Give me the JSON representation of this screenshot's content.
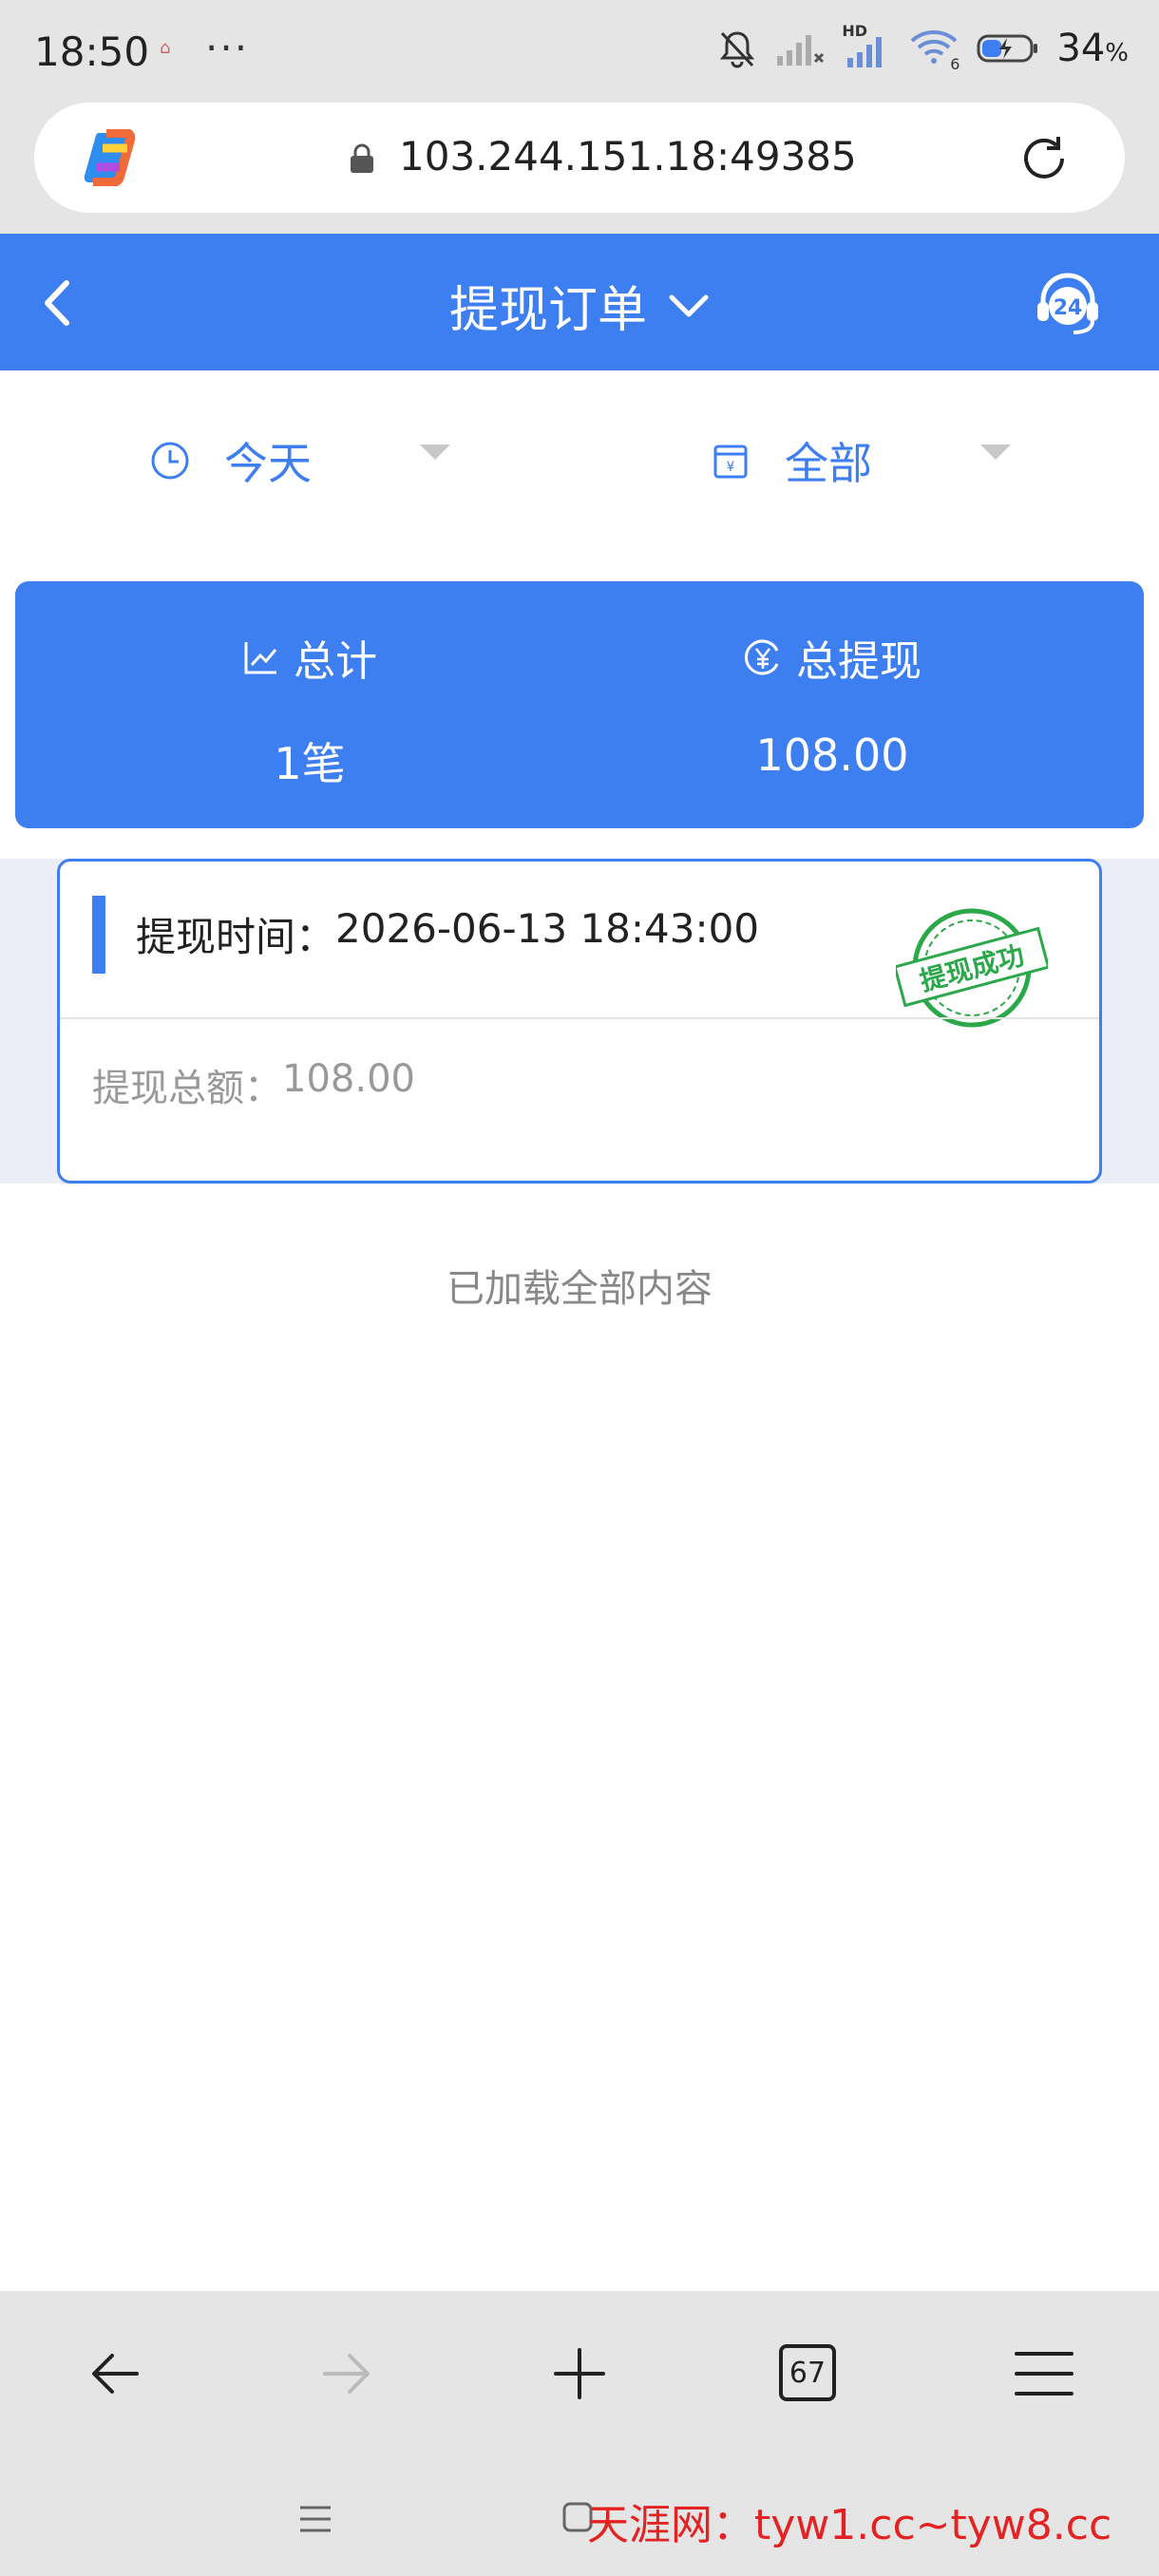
{
  "status_bar": {
    "time": "18:50",
    "tiny_label": "⌂",
    "more": "···",
    "network_label": "HD",
    "wifi_sub": "6",
    "battery_percent": "34",
    "battery_unit": "%"
  },
  "browser": {
    "url": "103.244.151.18:49385",
    "tab_count": "67"
  },
  "header": {
    "title": "提现订单"
  },
  "filters": {
    "date": "今天",
    "type": "全部"
  },
  "summary": {
    "count_label": "总计",
    "count_value": "1笔",
    "amount_label": "总提现",
    "amount_value": "108.00"
  },
  "orders": [
    {
      "time_label": "提现时间：",
      "time_value": "2026-06-13 18:43:00",
      "amount_label": "提现总额：",
      "amount_value": "108.00",
      "stamp_text": "提现成功"
    }
  ],
  "list_end_text": "已加载全部内容",
  "watermark": {
    "name": "天涯网：",
    "url": "tyw1.cc~tyw8.cc"
  },
  "colors": {
    "primary": "#3d7ef0",
    "stamp": "#2aa84a",
    "watermark": "#e52222"
  },
  "icons": {
    "date_filter": "clock-icon",
    "type_filter": "calendar-box-icon",
    "count": "trend-chart-icon",
    "amount": "yen-circle-icon"
  }
}
